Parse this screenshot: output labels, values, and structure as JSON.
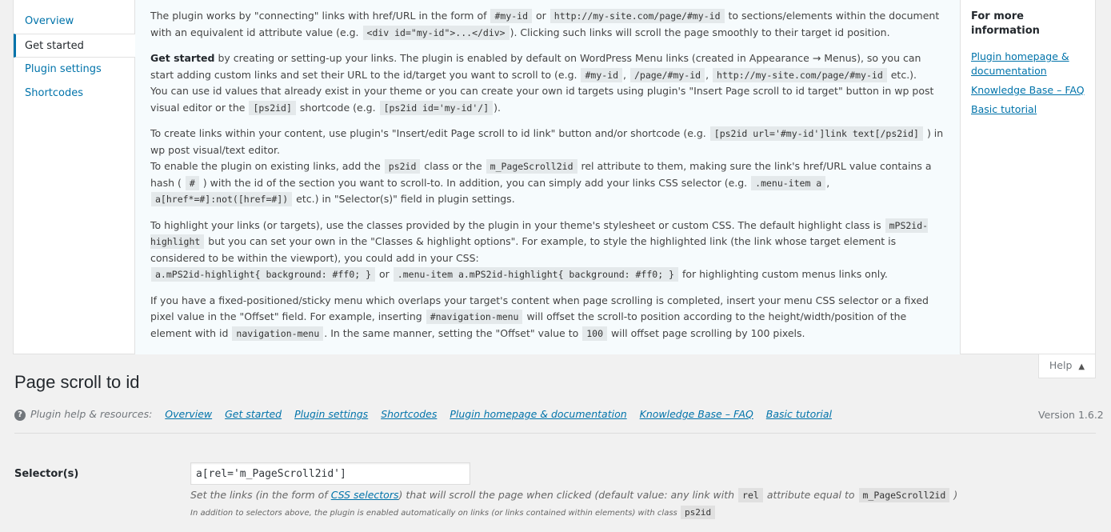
{
  "help": {
    "tabs": [
      "Overview",
      "Get started",
      "Plugin settings",
      "Shortcodes"
    ],
    "content": {
      "p1": {
        "t1": "The plugin works by \"connecting\" links with href/URL in the form of",
        "c1": "#my-id",
        "t2": "or",
        "c2": "http://my-site.com/page/#my-id",
        "t3": "to sections/elements within the document with an equivalent id attribute value (e.g.",
        "c3": "<div id=\"my-id\">...</div>",
        "t4": "). Clicking such links will scroll the page smoothly to their target id position."
      },
      "p2": {
        "strong": "Get started",
        "t1": "by creating or setting-up your links. The plugin is enabled by default on WordPress Menu links (created in Appearance → Menus), so you can start adding custom links and set their URL to the id/target you want to scroll to (e.g.",
        "c1": "#my-id",
        "c2": "/page/#my-id",
        "c3": "http://my-site.com/page/#my-id",
        "t2": "etc.).",
        "t3": "You can use id values that already exist in your theme or you can create your own id targets using plugin's \"Insert Page scroll to id target\" button in wp post visual editor or the",
        "c4": "[ps2id]",
        "t4": "shortcode (e.g.",
        "c5": "[ps2id id='my-id'/]",
        "t5": ")."
      },
      "p3": {
        "t1": "To create links within your content, use plugin's \"Insert/edit Page scroll to id link\" button and/or shortcode (e.g.",
        "c1": "[ps2id url='#my-id']link text[/ps2id]",
        "t2": ") in wp post visual/text editor.",
        "t3": "To enable the plugin on existing links, add the",
        "c2": "ps2id",
        "t4": "class or the",
        "c3": "m_PageScroll2id",
        "t5": "rel attribute to them, making sure the link's href/URL value contains a hash (",
        "c4": "#",
        "t6": ") with the id of the section you want to scroll-to. In addition, you can simply add your links CSS selector (e.g.",
        "c5": ".menu-item a",
        "c6": "a[href*=#]:not([href=#])",
        "t7": "etc.) in \"Selector(s)\" field in plugin settings."
      },
      "p4": {
        "t1": "To highlight your links (or targets), use the classes provided by the plugin in your theme's stylesheet or custom CSS. The default highlight class is",
        "c1": "mPS2id-highlight",
        "t2": "but you can set your own in the \"Classes & highlight options\". For example, to style the highlighted link (the link whose target element is considered to be within the viewport), you could add in your CSS:",
        "c2": "a.mPS2id-highlight{ background: #ff0; }",
        "t3": "or",
        "c3": ".menu-item a.mPS2id-highlight{ background: #ff0; }",
        "t4": "for highlighting custom menus links only."
      },
      "p5": {
        "t1": "If you have a fixed-positioned/sticky menu which overlaps your target's content when page scrolling is completed, insert your menu CSS selector or a fixed pixel value in the \"Offset\" field. For example, inserting",
        "c1": "#navigation-menu",
        "t2": "will offset the scroll-to position according to the height/width/position of the element with id",
        "c2": "navigation-menu",
        "t3": ". In the same manner, setting the \"Offset\" value to",
        "c3": "100",
        "t4": "will offset page scrolling by 100 pixels."
      }
    },
    "sidebar": {
      "title": "For more information",
      "links": [
        "Plugin homepage & documentation",
        "Knowledge Base – FAQ",
        "Basic tutorial"
      ]
    },
    "toggle_label": "Help",
    "toggle_arrow": "▲"
  },
  "page": {
    "title": "Page scroll to id",
    "resources_label": "Plugin help & resources:",
    "resources_links": [
      "Overview",
      "Get started",
      "Plugin settings",
      "Shortcodes",
      "Plugin homepage & documentation",
      "Knowledge Base – FAQ",
      "Basic tutorial"
    ],
    "version": "Version 1.6.2",
    "help_icon": "?"
  },
  "settings": {
    "selector": {
      "label": "Selector(s)",
      "value": "a[rel='m_PageScroll2id']",
      "desc_t1": "Set the links (in the form of",
      "desc_link": "CSS selectors",
      "desc_t2": ") that will scroll the page when clicked (default value: any link with",
      "desc_c1": "rel",
      "desc_t3": "attribute equal to",
      "desc_c2": "m_PageScroll2id",
      "desc_t4": ")",
      "note_t1": "In addition to selectors above, the plugin is enabled automatically on links (or links contained within elements) with class",
      "note_c1": "ps2id"
    }
  }
}
